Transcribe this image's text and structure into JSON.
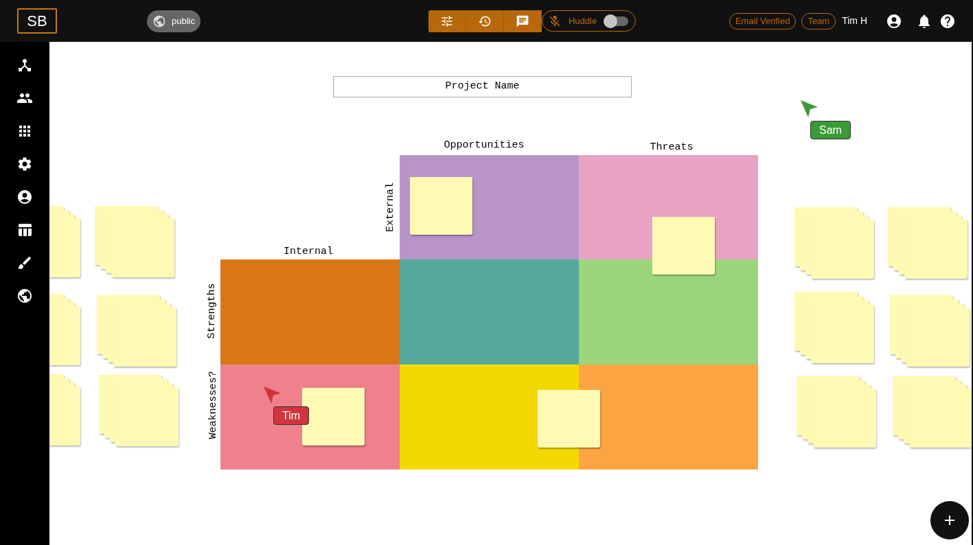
{
  "topbar": {
    "logo": "SB",
    "visibility": "public",
    "huddle": {
      "label": "Huddle",
      "on": false
    },
    "badges": [
      "Email Verified",
      "Team"
    ],
    "user": "Tim H"
  },
  "canvas": {
    "project_name": "Project Name",
    "axis_labels": [
      {
        "text": "Opportunities",
        "vertical": false
      },
      {
        "text": "Threats",
        "vertical": false
      },
      {
        "text": "External",
        "vertical": true
      },
      {
        "text": "Internal",
        "vertical": false
      },
      {
        "text": "Strengths",
        "vertical": true
      },
      {
        "text": "Weaknesses?",
        "vertical": true
      }
    ],
    "cells": [
      {
        "color": "#b994c8"
      },
      {
        "color": "#e8a3c4"
      },
      {
        "color": "#d97718"
      },
      {
        "color": "#57a89c"
      },
      {
        "color": "#9bd67d"
      },
      {
        "color": "#ee818d"
      },
      {
        "color": "#f3d900"
      },
      {
        "color": "#fca441"
      }
    ],
    "cursors": [
      {
        "name": "Sam",
        "color": "#3a9a35"
      },
      {
        "name": "Tim",
        "color": "#d0343f"
      }
    ]
  }
}
